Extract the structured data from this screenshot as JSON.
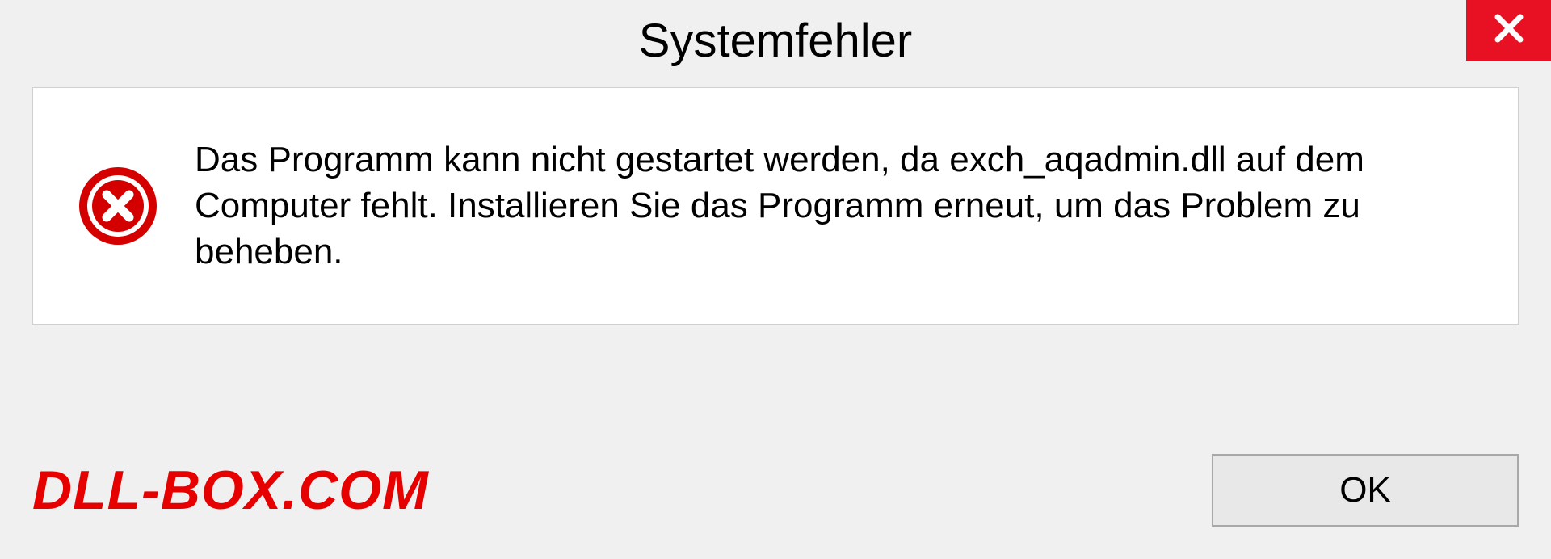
{
  "titlebar": {
    "title": "Systemfehler"
  },
  "dialog": {
    "message": "Das Programm kann nicht gestartet werden, da exch_aqadmin.dll auf dem Computer fehlt. Installieren Sie das Programm erneut, um das Problem zu beheben."
  },
  "footer": {
    "watermark": "DLL-BOX.COM",
    "ok_label": "OK"
  },
  "colors": {
    "close_bg": "#e81123",
    "error_icon": "#d40000",
    "watermark": "#e60000"
  }
}
